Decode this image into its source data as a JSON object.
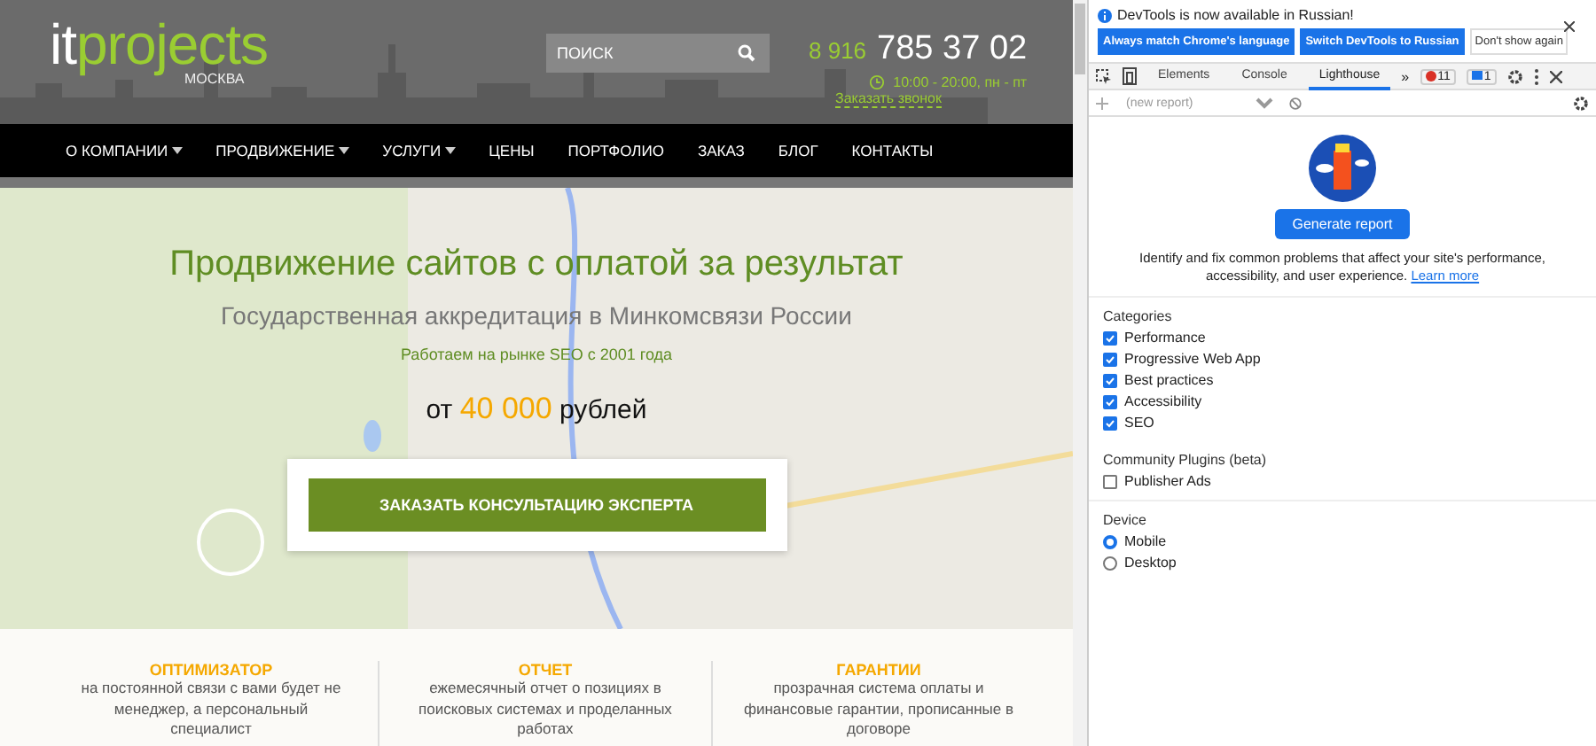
{
  "site": {
    "logo": {
      "it": "it",
      "projects": "projects",
      "city": "МОСКВА"
    },
    "search": {
      "placeholder": "ПОИСК"
    },
    "phone": {
      "prefix": "8 916",
      "number": "785 37 02"
    },
    "hours": "10:00 - 20:00, пн - пт",
    "callback": "Заказать звонок",
    "nav": [
      {
        "label": "О КОМПАНИИ",
        "dropdown": true
      },
      {
        "label": "ПРОДВИЖЕНИЕ",
        "dropdown": true
      },
      {
        "label": "УСЛУГИ",
        "dropdown": true
      },
      {
        "label": "ЦЕНЫ",
        "dropdown": false
      },
      {
        "label": "ПОРТФОЛИО",
        "dropdown": false
      },
      {
        "label": "ЗАКАЗ",
        "dropdown": false
      },
      {
        "label": "БЛОГ",
        "dropdown": false
      },
      {
        "label": "КОНТАКТЫ",
        "dropdown": false
      }
    ],
    "hero": {
      "title": "Продвижение сайтов с оплатой за результат",
      "subtitle": "Государственная аккредитация в Минкомсвязи России",
      "note": "Работаем на рынке SEO с 2001 года",
      "price_prefix": "от",
      "price_amount": "40 000",
      "price_suffix": "рублей",
      "cta": "ЗАКАЗАТЬ КОНСУЛЬТАЦИЮ ЭКСПЕРТА"
    },
    "features": [
      {
        "title": "ОПТИМИЗАТОР",
        "text": "на постоянной связи с вами будет не менеджер, а персональный специалист"
      },
      {
        "title": "ОТЧЕТ",
        "text": "ежемесячный отчет о позициях в поисковых системах и проделанных работах"
      },
      {
        "title": "ГАРАНТИИ",
        "text": "прозрачная система оплаты и финансовые гарантии, прописанные в договоре"
      }
    ]
  },
  "devtools": {
    "infobar": {
      "message": "DevTools is now available in Russian!",
      "buttons": [
        {
          "label": "Always match Chrome's language",
          "kind": "primary"
        },
        {
          "label": "Switch DevTools to Russian",
          "kind": "primary"
        },
        {
          "label": "Don't show again",
          "kind": "plain"
        }
      ]
    },
    "tabs": [
      {
        "label": "Elements",
        "selected": false
      },
      {
        "label": "Console",
        "selected": false
      },
      {
        "label": "Lighthouse",
        "selected": true
      }
    ],
    "more": "»",
    "errors": "11",
    "messages": "1",
    "report": {
      "placeholder": "(new report)"
    },
    "generate": "Generate report",
    "description": "Identify and fix common problems that affect your site's performance, accessibility, and user experience.",
    "learn_more": "Learn more",
    "categories": {
      "heading": "Categories",
      "items": [
        {
          "label": "Performance",
          "checked": true
        },
        {
          "label": "Progressive Web App",
          "checked": true
        },
        {
          "label": "Best practices",
          "checked": true
        },
        {
          "label": "Accessibility",
          "checked": true
        },
        {
          "label": "SEO",
          "checked": true
        }
      ]
    },
    "plugins": {
      "heading": "Community Plugins (beta)",
      "items": [
        {
          "label": "Publisher Ads",
          "checked": false
        }
      ]
    },
    "device": {
      "heading": "Device",
      "options": [
        {
          "label": "Mobile",
          "selected": true
        },
        {
          "label": "Desktop",
          "selected": false
        }
      ]
    }
  }
}
